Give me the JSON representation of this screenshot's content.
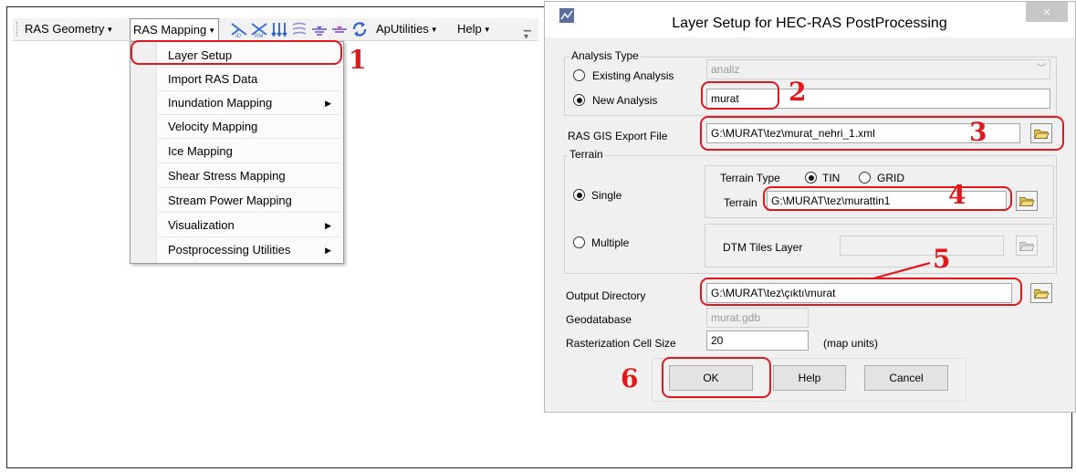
{
  "toolbar": {
    "menus": [
      "RAS Geometry",
      "RAS Mapping",
      "ApUtilities",
      "Help"
    ],
    "icons": [
      "xs-lines-id-icon",
      "bank-points-rm-icon",
      "flow-paths-icon",
      "stream-lines-icon",
      "water-surface-icon",
      "water-surface-alt-icon",
      "refresh-icon"
    ]
  },
  "dropdown": {
    "items": [
      {
        "label": "Layer Setup",
        "submenu": false
      },
      {
        "label": "Import RAS Data",
        "submenu": false
      },
      {
        "label": "Inundation Mapping",
        "submenu": true
      },
      {
        "label": "Velocity Mapping",
        "submenu": false
      },
      {
        "label": "Ice Mapping",
        "submenu": false
      },
      {
        "label": "Shear Stress Mapping",
        "submenu": false
      },
      {
        "label": "Stream Power Mapping",
        "submenu": false
      },
      {
        "label": "Visualization",
        "submenu": true
      },
      {
        "label": "Postprocessing Utilities",
        "submenu": true
      }
    ]
  },
  "dialog": {
    "title": "Layer Setup for HEC-RAS PostProcessing",
    "close_label": "×",
    "analysis_type": {
      "group_label": "Analysis Type",
      "existing_label": "Existing Analysis",
      "existing_value": "analiz",
      "new_label": "New Analysis",
      "new_value": "murat",
      "selected": "New Analysis"
    },
    "export_file": {
      "label": "RAS GIS Export File",
      "value": "G:\\MURAT\\tez\\murat_nehri_1.xml"
    },
    "terrain": {
      "group_label": "Terrain",
      "single_label": "Single",
      "multiple_label": "Multiple",
      "selected": "Single",
      "terrain_type_label": "Terrain Type",
      "tin_label": "TIN",
      "grid_label": "GRID",
      "terrain_type_selected": "TIN",
      "terrain_label": "Terrain",
      "terrain_value": "G:\\MURAT\\tez\\murattin1",
      "dtm_label": "DTM Tiles Layer",
      "dtm_value": ""
    },
    "output_dir": {
      "label": "Output Directory",
      "value": "G:\\MURAT\\tez\\çıktı\\murat"
    },
    "geodatabase": {
      "label": "Geodatabase",
      "value": "murat.gdb"
    },
    "cell_size": {
      "label": "Rasterization Cell Size",
      "value": "20",
      "units": "(map units)"
    },
    "buttons": {
      "ok": "OK",
      "help": "Help",
      "cancel": "Cancel"
    }
  },
  "annotations": {
    "colors": {
      "annotation": "#e0191c"
    },
    "numbers": [
      "1",
      "2",
      "3",
      "4",
      "5",
      "6"
    ]
  }
}
